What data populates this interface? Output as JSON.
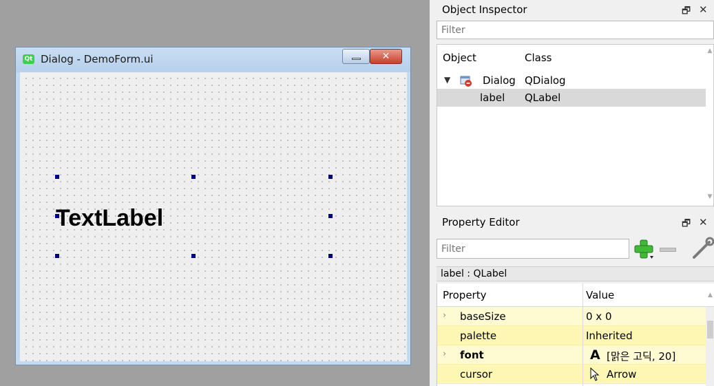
{
  "dialog": {
    "icon_text": "Qt",
    "title": "Dialog - DemoForm.ui",
    "close_glyph": "✕",
    "label_text": "TextLabel"
  },
  "object_inspector": {
    "title": "Object Inspector",
    "float_glyph": "🗗",
    "close_glyph": "✕",
    "filter_placeholder": "Filter",
    "columns": [
      "Object",
      "Class"
    ],
    "rows": [
      {
        "object": "Dialog",
        "class": "QDialog",
        "icon": "dialog-icon",
        "expanded": true
      },
      {
        "object": "label",
        "class": "QLabel",
        "selected": true
      }
    ]
  },
  "property_editor": {
    "title": "Property Editor",
    "float_glyph": "🗗",
    "close_glyph": "✕",
    "filter_placeholder": "Filter",
    "object_name": "label : QLabel",
    "columns": [
      "Property",
      "Value"
    ],
    "rows": [
      {
        "name": "baseSize",
        "value": "0 x 0",
        "expandable": true
      },
      {
        "name": "palette",
        "value": "Inherited"
      },
      {
        "name": "font",
        "value": "[맑은 고딕, 20]",
        "glyph": "A",
        "expandable": true,
        "bold": true
      },
      {
        "name": "cursor",
        "value": "Arrow",
        "icon": "arrow-cursor-icon"
      }
    ],
    "expander_glyph": "›",
    "add_icon": "add-property-icon",
    "remove_icon": "remove-property-icon",
    "config_icon": "configure-icon"
  },
  "colors": {
    "accent_green": "#3fb936",
    "selection_handle": "#000080",
    "row_yellow": "#fefbd2"
  }
}
